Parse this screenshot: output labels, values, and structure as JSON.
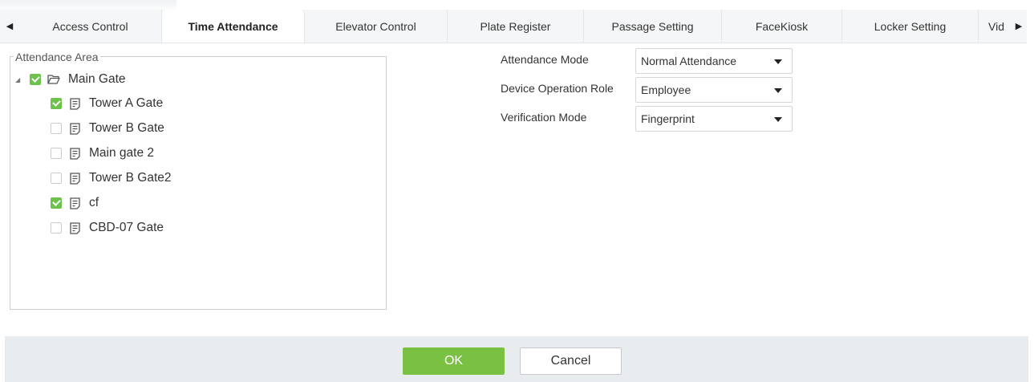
{
  "tabs": {
    "left_arrow": "◀",
    "right_arrow": "▶",
    "items": [
      {
        "label": "Access Control"
      },
      {
        "label": "Time Attendance"
      },
      {
        "label": "Elevator Control"
      },
      {
        "label": "Plate Register"
      },
      {
        "label": "Passage Setting"
      },
      {
        "label": "FaceKiosk"
      },
      {
        "label": "Locker Setting"
      },
      {
        "label": "Vid"
      }
    ],
    "active_index": 1
  },
  "attendance_area": {
    "legend": "Attendance Area",
    "root": {
      "label": "Main Gate",
      "checked": true,
      "icon": "folder-open-icon",
      "expanded": true
    },
    "children": [
      {
        "label": "Tower A Gate",
        "checked": true,
        "icon": "document-icon"
      },
      {
        "label": "Tower B Gate",
        "checked": false,
        "icon": "document-icon"
      },
      {
        "label": "Main gate 2",
        "checked": false,
        "icon": "document-icon"
      },
      {
        "label": "Tower B Gate2",
        "checked": false,
        "icon": "document-icon"
      },
      {
        "label": "cf",
        "checked": true,
        "icon": "document-icon"
      },
      {
        "label": "CBD-07 Gate",
        "checked": false,
        "icon": "document-icon"
      }
    ]
  },
  "form": {
    "attendance_mode": {
      "label": "Attendance Mode",
      "value": "Normal Attendance"
    },
    "device_operation_role": {
      "label": "Device Operation Role",
      "value": "Employee"
    },
    "verification_mode": {
      "label": "Verification Mode",
      "value": "Fingerprint"
    }
  },
  "footer": {
    "ok_label": "OK",
    "cancel_label": "Cancel"
  },
  "colors": {
    "accent_green": "#7ac143",
    "checkbox_green": "#6cc24a",
    "footer_bg": "#e9ecef"
  }
}
